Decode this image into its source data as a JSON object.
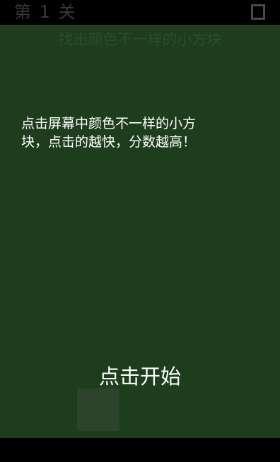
{
  "header": {
    "level_label": "第 1 关",
    "menu_icon": "square-outline-icon"
  },
  "game": {
    "subtitle": "找出颜色不一样的小方块",
    "instructions": "点击屏幕中颜色不一样的小方\n块，点击的越快，分数越高！",
    "start_label": "点击开始"
  },
  "colors": {
    "background": "#1d3d1d",
    "tile": "#2c442c",
    "text": "#ffffff",
    "bars": "#000000"
  }
}
